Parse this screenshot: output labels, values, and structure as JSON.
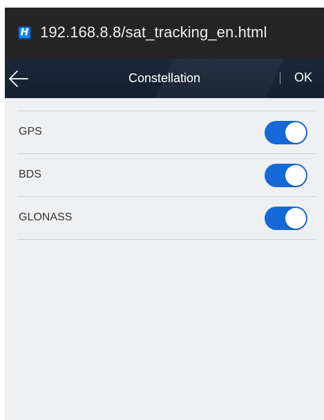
{
  "browser": {
    "site_icon_letter": "H",
    "url": "192.168.8.8/sat_tracking_en.html"
  },
  "header": {
    "back_icon": "arrow-left-icon",
    "title": "Constellation",
    "ok_label": "OK"
  },
  "constellations": [
    {
      "label": "GPS",
      "enabled": true
    },
    {
      "label": "BDS",
      "enabled": true
    },
    {
      "label": "GLONASS",
      "enabled": true
    }
  ],
  "colors": {
    "toggle_on": "#1669d6",
    "header_bg": "#1b2838",
    "url_bar_bg": "#242424",
    "page_bg": "#eff0f2"
  }
}
